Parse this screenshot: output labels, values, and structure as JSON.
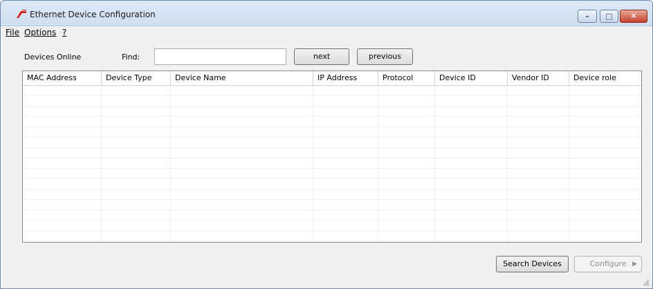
{
  "window": {
    "title": "Ethernet Device Configuration"
  },
  "menu": {
    "items": [
      "File",
      "Options",
      "?"
    ]
  },
  "toolbar": {
    "devices_online_label": "Devices Online",
    "find_label": "Find:",
    "find_value": "",
    "next_label": "next",
    "previous_label": "previous"
  },
  "table": {
    "columns": [
      "MAC Address",
      "Device Type",
      "Device Name",
      "IP Address",
      "Protocol",
      "Device ID",
      "Vendor ID",
      "Device role"
    ],
    "rows": []
  },
  "footer": {
    "search_label": "Search Devices",
    "configure_label": "Configure"
  },
  "icons": {
    "app": "ethernet-app-icon",
    "minimize": "minimize-icon",
    "maximize": "maximize-icon",
    "close": "close-icon",
    "configure_arrow": "chevron-right-icon",
    "resize": "resize-grip-icon"
  },
  "colors": {
    "app_icon": "#d9251d",
    "close_button": "#c4402a"
  }
}
